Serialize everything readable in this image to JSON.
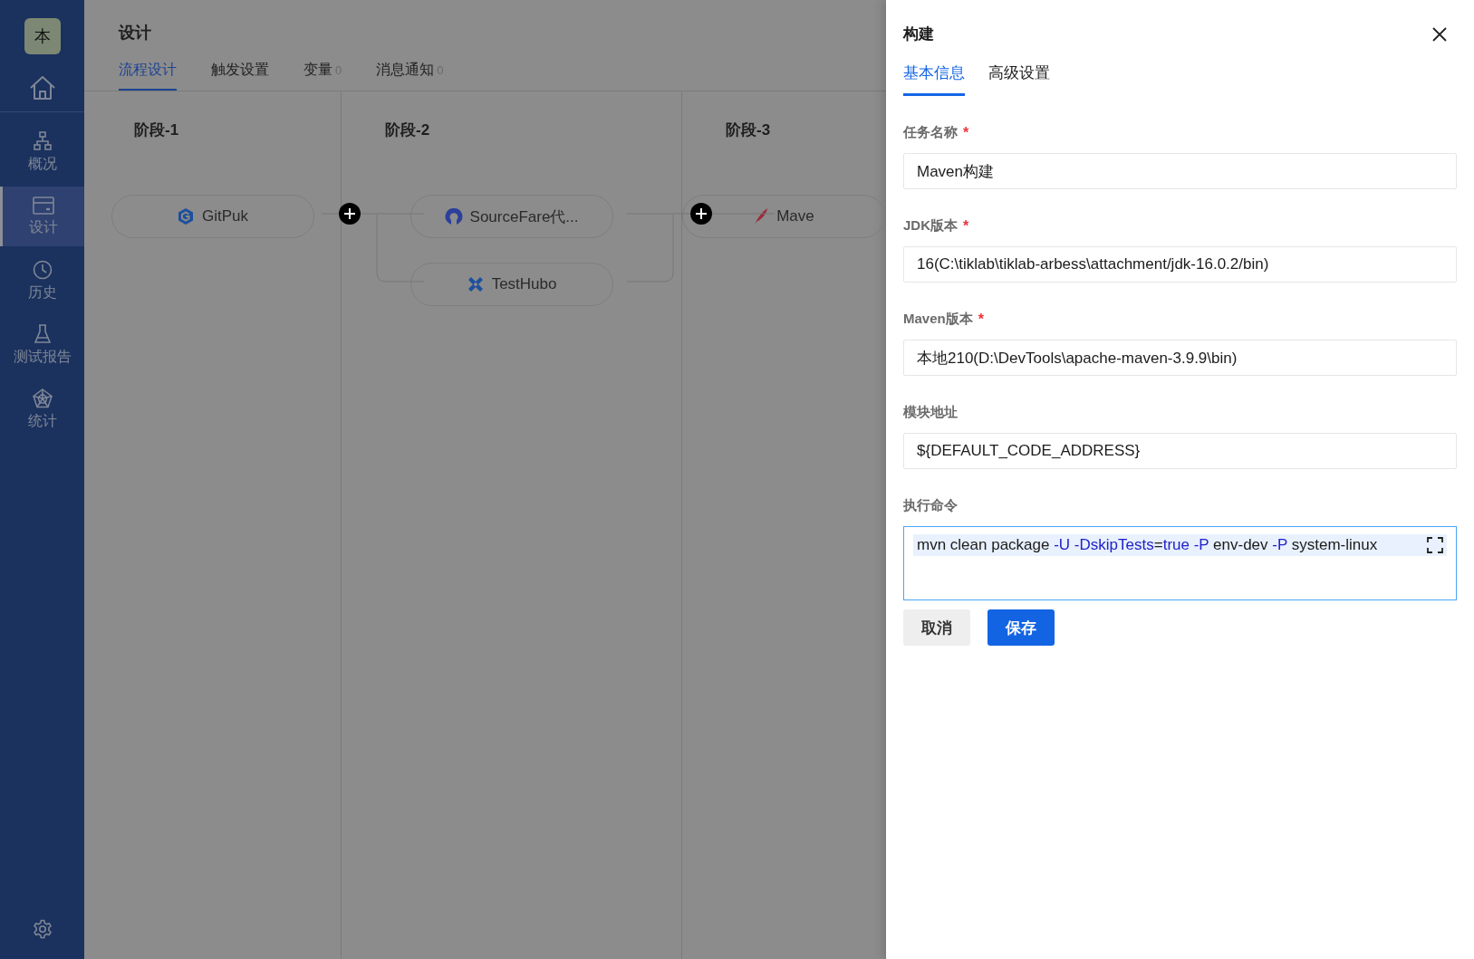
{
  "sidebar": {
    "logo": "本",
    "items": [
      {
        "kind": "overview",
        "label": "概况",
        "selected": false
      },
      {
        "kind": "design",
        "label": "设计",
        "selected": true
      },
      {
        "kind": "history",
        "label": "历史",
        "selected": false
      },
      {
        "kind": "test",
        "label": "测试报告",
        "selected": false
      },
      {
        "kind": "stats",
        "label": "统计",
        "selected": false
      }
    ]
  },
  "header": {
    "title": "设计",
    "tabs": [
      {
        "label": "流程设计",
        "selected": true
      },
      {
        "label": "触发设置",
        "selected": false
      },
      {
        "label": "变量",
        "count": "0",
        "selected": false
      },
      {
        "label": "消息通知",
        "count": "0",
        "selected": false
      }
    ]
  },
  "stages": [
    {
      "title": "阶段-1",
      "tasks": [
        {
          "kind": "gitpuk",
          "label": "GitPuk"
        }
      ]
    },
    {
      "title": "阶段-2",
      "tasks": [
        {
          "kind": "sourcefare",
          "label": "SourceFare代..."
        },
        {
          "kind": "testhubo",
          "label": "TestHubo"
        }
      ]
    },
    {
      "title": "阶段-3",
      "tasks": [
        {
          "kind": "maven",
          "label": "Mave"
        }
      ]
    }
  ],
  "drawer": {
    "title": "构建",
    "tabs": [
      {
        "label": "基本信息",
        "selected": true
      },
      {
        "label": "高级设置",
        "selected": false
      }
    ],
    "fields": [
      {
        "kind": "input",
        "label": "任务名称",
        "required_mark": "*",
        "value": "Maven构建"
      },
      {
        "kind": "input",
        "label": "JDK版本",
        "required_mark": "*",
        "value": "16(C:\\tiklab\\tiklab-arbess\\attachment/jdk-16.0.2/bin)"
      },
      {
        "kind": "input",
        "label": "Maven版本",
        "required_mark": "*",
        "value": "本地210(D:\\DevTools\\apache-maven-3.9.9\\bin)"
      },
      {
        "kind": "input",
        "label": "模块地址",
        "value": "${DEFAULT_CODE_ADDRESS}"
      },
      {
        "kind": "code",
        "label": "执行命令",
        "tokens": [
          {
            "kind": "plain",
            "text": "mvn clean package "
          },
          {
            "kind": "flag",
            "text": "-U -DskipTests"
          },
          {
            "kind": "plain",
            "text": "="
          },
          {
            "kind": "flag",
            "text": "true -P"
          },
          {
            "kind": "plain",
            "text": " env-dev "
          },
          {
            "kind": "flag",
            "text": "-P"
          },
          {
            "kind": "plain",
            "text": " system-linux"
          }
        ]
      }
    ],
    "buttons": [
      {
        "kind": "default",
        "label": "取消"
      },
      {
        "kind": "primary",
        "label": "保存"
      }
    ]
  }
}
